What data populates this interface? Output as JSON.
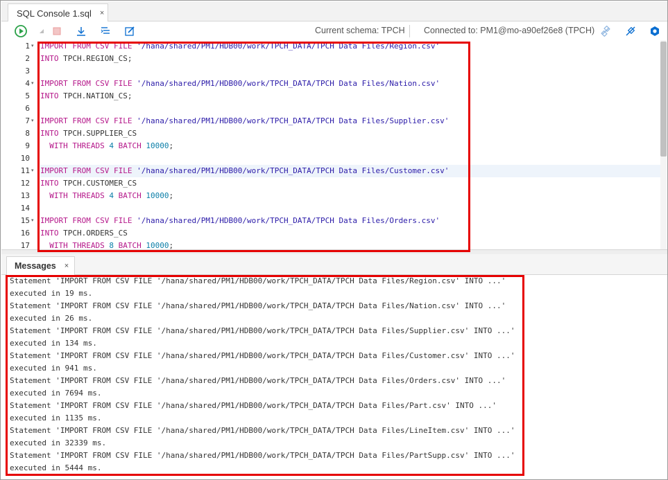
{
  "window": {
    "tab_title": "SQL Console 1.sql",
    "tab_close": "×"
  },
  "toolbar": {
    "run_icon": "run-icon",
    "stop_icon": "stop-icon",
    "download_icon": "download-icon",
    "format_icon": "format-icon",
    "edit_icon": "edit-icon",
    "schema_label": "Current schema: TPCH",
    "connection_label": "Connected to: PM1@mo-a90ef26e8 (TPCH)",
    "disconnect_icon": "disconnect-icon",
    "connection_icon": "plug-icon",
    "settings_icon": "gear-icon"
  },
  "editor": {
    "line_numbers": [
      "1",
      "2",
      "3",
      "4",
      "5",
      "6",
      "7",
      "8",
      "9",
      "10",
      "11",
      "12",
      "13",
      "14",
      "15",
      "16",
      "17"
    ],
    "lines": [
      {
        "fold": true,
        "tokens": [
          {
            "t": "kw",
            "v": "IMPORT FROM CSV FILE"
          },
          {
            "t": "plain",
            "v": " "
          },
          {
            "t": "str",
            "v": "'/hana/shared/PM1/HDB00/work/TPCH_DATA/TPCH Data Files/Region.csv'"
          }
        ]
      },
      {
        "fold": false,
        "tokens": [
          {
            "t": "kw",
            "v": "INTO"
          },
          {
            "t": "plain",
            "v": " TPCH.REGION_CS;"
          }
        ]
      },
      {
        "fold": false,
        "tokens": []
      },
      {
        "fold": true,
        "tokens": [
          {
            "t": "kw",
            "v": "IMPORT FROM CSV FILE"
          },
          {
            "t": "plain",
            "v": " "
          },
          {
            "t": "str",
            "v": "'/hana/shared/PM1/HDB00/work/TPCH_DATA/TPCH Data Files/Nation.csv'"
          }
        ]
      },
      {
        "fold": false,
        "tokens": [
          {
            "t": "kw",
            "v": "INTO"
          },
          {
            "t": "plain",
            "v": " TPCH.NATION_CS;"
          }
        ]
      },
      {
        "fold": false,
        "tokens": []
      },
      {
        "fold": true,
        "tokens": [
          {
            "t": "kw",
            "v": "IMPORT FROM CSV FILE"
          },
          {
            "t": "plain",
            "v": " "
          },
          {
            "t": "str",
            "v": "'/hana/shared/PM1/HDB00/work/TPCH_DATA/TPCH Data Files/Supplier.csv'"
          }
        ]
      },
      {
        "fold": false,
        "tokens": [
          {
            "t": "kw",
            "v": "INTO"
          },
          {
            "t": "plain",
            "v": " TPCH.SUPPLIER_CS"
          }
        ]
      },
      {
        "fold": false,
        "tokens": [
          {
            "t": "plain",
            "v": "  "
          },
          {
            "t": "kw",
            "v": "WITH THREADS"
          },
          {
            "t": "plain",
            "v": " "
          },
          {
            "t": "num",
            "v": "4"
          },
          {
            "t": "plain",
            "v": " "
          },
          {
            "t": "kw",
            "v": "BATCH"
          },
          {
            "t": "plain",
            "v": " "
          },
          {
            "t": "num",
            "v": "10000"
          },
          {
            "t": "plain",
            "v": ";"
          }
        ]
      },
      {
        "fold": false,
        "tokens": []
      },
      {
        "fold": true,
        "active": true,
        "tokens": [
          {
            "t": "kw",
            "v": "IMPORT FROM CSV FILE"
          },
          {
            "t": "plain",
            "v": " "
          },
          {
            "t": "str",
            "v": "'/hana/shared/PM1/HDB00/work/TPCH_DATA/TPCH Data Files/Customer.csv'"
          }
        ]
      },
      {
        "fold": false,
        "tokens": [
          {
            "t": "kw",
            "v": "INTO"
          },
          {
            "t": "plain",
            "v": " TPCH.CUSTOMER_CS"
          }
        ]
      },
      {
        "fold": false,
        "tokens": [
          {
            "t": "plain",
            "v": "  "
          },
          {
            "t": "kw",
            "v": "WITH THREADS"
          },
          {
            "t": "plain",
            "v": " "
          },
          {
            "t": "num",
            "v": "4"
          },
          {
            "t": "plain",
            "v": " "
          },
          {
            "t": "kw",
            "v": "BATCH"
          },
          {
            "t": "plain",
            "v": " "
          },
          {
            "t": "num",
            "v": "10000"
          },
          {
            "t": "plain",
            "v": ";"
          }
        ]
      },
      {
        "fold": false,
        "tokens": []
      },
      {
        "fold": true,
        "tokens": [
          {
            "t": "kw",
            "v": "IMPORT FROM CSV FILE"
          },
          {
            "t": "plain",
            "v": " "
          },
          {
            "t": "str",
            "v": "'/hana/shared/PM1/HDB00/work/TPCH_DATA/TPCH Data Files/Orders.csv'"
          }
        ]
      },
      {
        "fold": false,
        "tokens": [
          {
            "t": "kw",
            "v": "INTO"
          },
          {
            "t": "plain",
            "v": " TPCH.ORDERS_CS"
          }
        ]
      },
      {
        "fold": false,
        "tokens": [
          {
            "t": "plain",
            "v": "  "
          },
          {
            "t": "kw",
            "v": "WITH THREADS"
          },
          {
            "t": "plain",
            "v": " "
          },
          {
            "t": "num",
            "v": "8"
          },
          {
            "t": "plain",
            "v": " "
          },
          {
            "t": "kw",
            "v": "BATCH"
          },
          {
            "t": "plain",
            "v": " "
          },
          {
            "t": "num",
            "v": "10000"
          },
          {
            "t": "plain",
            "v": ";"
          }
        ]
      }
    ]
  },
  "messages": {
    "tab_title": "Messages",
    "tab_close": "×",
    "lines": [
      "Statement 'IMPORT FROM CSV FILE '/hana/shared/PM1/HDB00/work/TPCH_DATA/TPCH Data Files/Region.csv' INTO ...'",
      "executed in 19 ms.",
      "Statement 'IMPORT FROM CSV FILE '/hana/shared/PM1/HDB00/work/TPCH_DATA/TPCH Data Files/Nation.csv' INTO ...'",
      "executed in 26 ms.",
      "Statement 'IMPORT FROM CSV FILE '/hana/shared/PM1/HDB00/work/TPCH_DATA/TPCH Data Files/Supplier.csv' INTO ...'",
      "executed in 134 ms.",
      "Statement 'IMPORT FROM CSV FILE '/hana/shared/PM1/HDB00/work/TPCH_DATA/TPCH Data Files/Customer.csv' INTO ...'",
      "executed in 941 ms.",
      "Statement 'IMPORT FROM CSV FILE '/hana/shared/PM1/HDB00/work/TPCH_DATA/TPCH Data Files/Orders.csv' INTO ...'",
      "executed in 7694 ms.",
      "Statement 'IMPORT FROM CSV FILE '/hana/shared/PM1/HDB00/work/TPCH_DATA/TPCH Data Files/Part.csv' INTO ...'",
      "executed in 1135 ms.",
      "Statement 'IMPORT FROM CSV FILE '/hana/shared/PM1/HDB00/work/TPCH_DATA/TPCH Data Files/LineItem.csv' INTO ...'",
      "executed in 32339 ms.",
      "Statement 'IMPORT FROM CSV FILE '/hana/shared/PM1/HDB00/work/TPCH_DATA/TPCH Data Files/PartSupp.csv' INTO ...'",
      "executed in 5444 ms."
    ]
  },
  "colors": {
    "keyword": "#b5178a",
    "string": "#2a1aa8",
    "number": "#0b7ea8",
    "run_green": "#2aa148",
    "toolbar_blue": "#0a6ed1",
    "highlight_red": "#e60000"
  }
}
